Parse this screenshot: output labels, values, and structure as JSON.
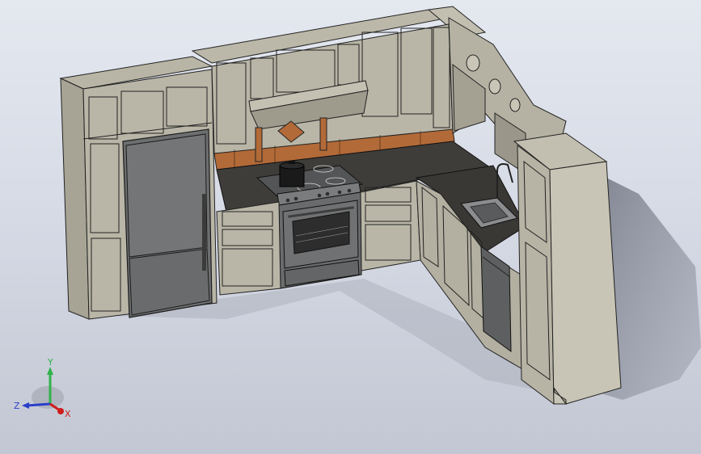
{
  "viewport": {
    "background_top": "#e4e8ef",
    "background_bottom": "#c3c7d3"
  },
  "model": {
    "cabinet_color": "#b7b4a4",
    "cabinet_shadow": "#8f8c7d",
    "counter_color": "#3f3d3a",
    "steel_color": "#6e6f70",
    "backsplash_color": "#b5642e"
  },
  "triad": {
    "y_label": "Y",
    "z_label": "Z",
    "x_label": "X",
    "y_color": "#2fb24a",
    "z_color": "#2a3fc8",
    "x_color": "#d01d1d"
  }
}
